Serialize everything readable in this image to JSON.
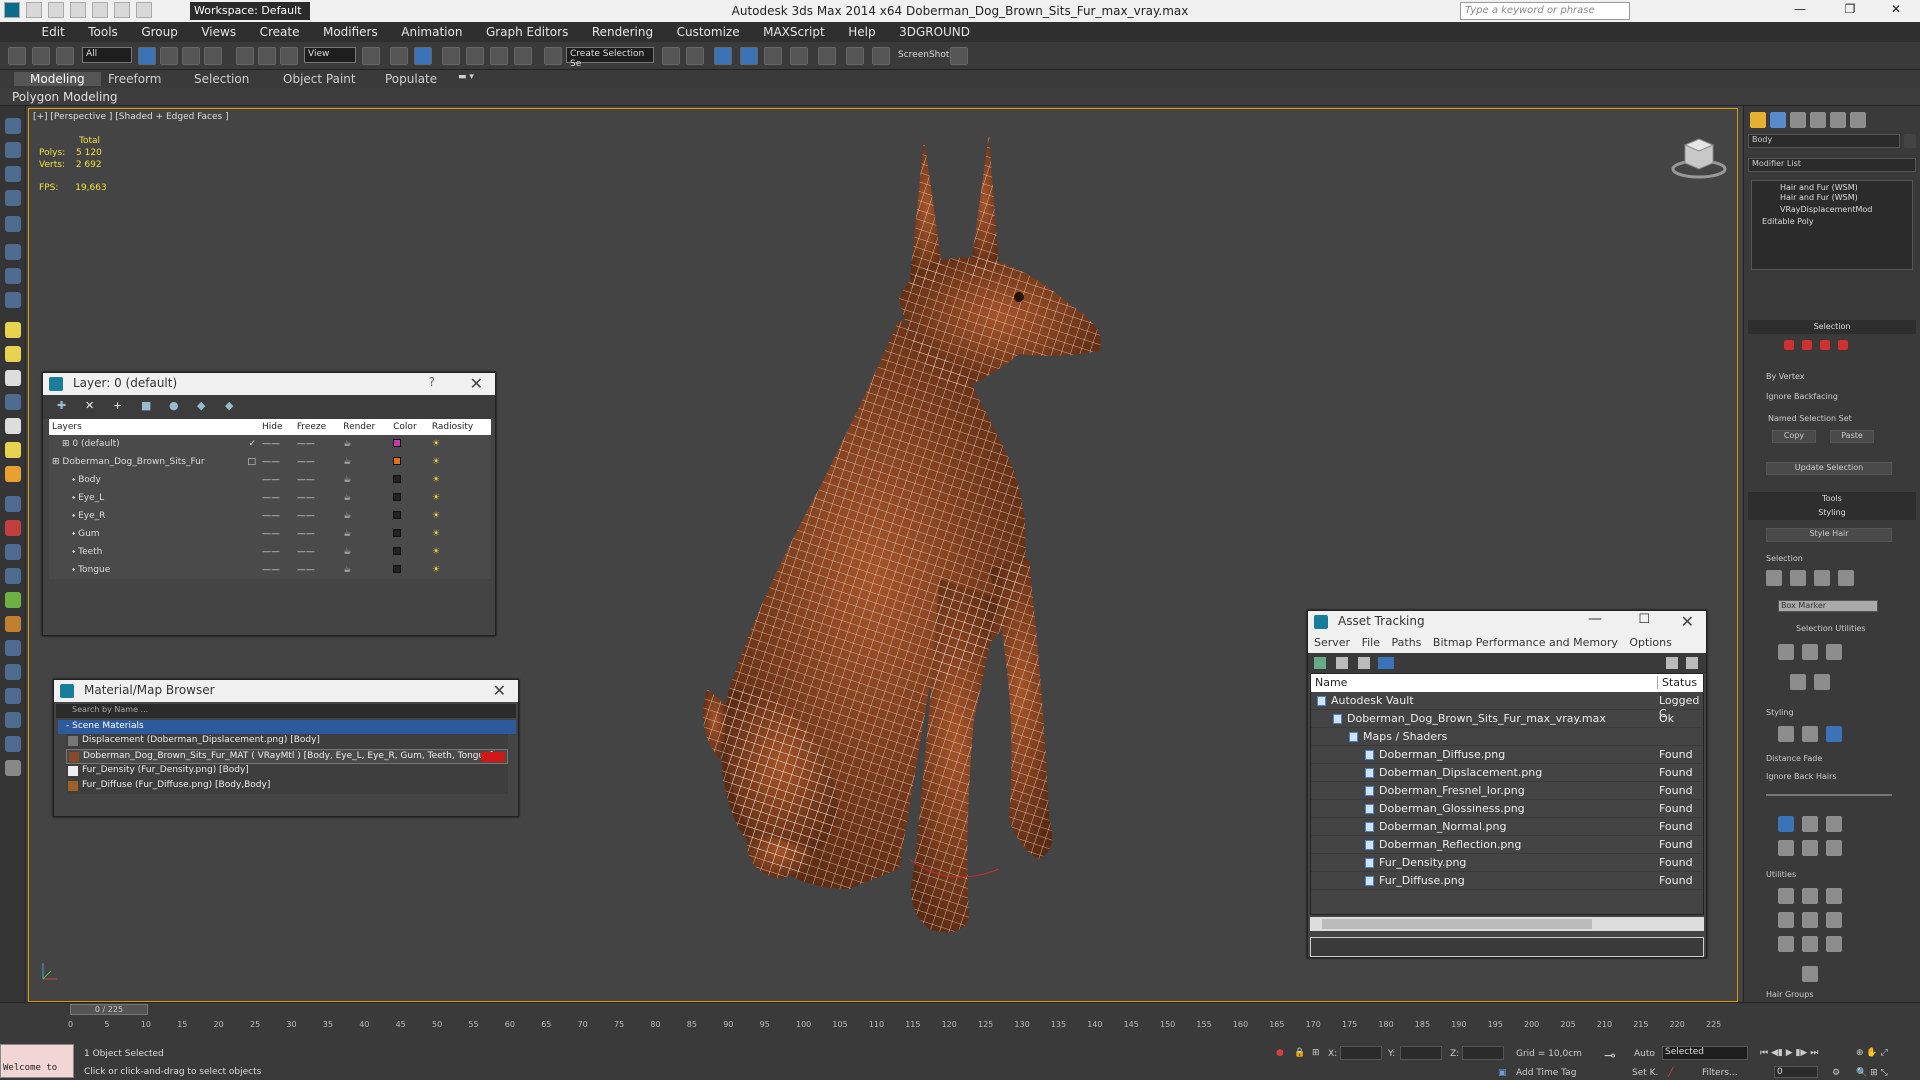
{
  "app": {
    "title": "Autodesk 3ds Max  2014 x64     Doberman_Dog_Brown_Sits_Fur_max_vray.max",
    "workspace": "Workspace: Default",
    "search_placeholder": "Type a keyword or phrase"
  },
  "menu": [
    "Edit",
    "Tools",
    "Group",
    "Views",
    "Create",
    "Modifiers",
    "Animation",
    "Graph Editors",
    "Rendering",
    "Customize",
    "MAXScript",
    "Help",
    "3DGROUND"
  ],
  "toolbar": {
    "filter": "All",
    "ref_coord": "View",
    "named_sel": "Create Selection Se",
    "screenshot": "ScreenShot"
  },
  "ribbon": {
    "tabs": [
      "Modeling",
      "Freeform",
      "Selection",
      "Object Paint",
      "Populate"
    ],
    "active_tab": "Modeling",
    "sub": "Polygon Modeling"
  },
  "viewport": {
    "label": "[+] [Perspective ] [Shaded + Edged Faces ]",
    "stats_total": "Total",
    "polys_label": "Polys:",
    "polys": "5 120",
    "verts_label": "Verts:",
    "verts": "2 692",
    "fps_label": "FPS:",
    "fps": "19,663"
  },
  "layer_panel": {
    "title": "Layer: 0 (default)",
    "columns": [
      "Layers",
      "Hide",
      "Freeze",
      "Render",
      "Color",
      "Radiosity"
    ],
    "rows": [
      {
        "name": "0 (default)",
        "indent": 1,
        "color": "#c03ab0",
        "check": "✓"
      },
      {
        "name": "Doberman_Dog_Brown_Sits_Fur",
        "indent": 0,
        "color": "#e07020",
        "check": "□"
      },
      {
        "name": "Body",
        "indent": 2,
        "color": "#222222",
        "check": ""
      },
      {
        "name": "Eye_L",
        "indent": 2,
        "color": "#222222",
        "check": ""
      },
      {
        "name": "Eye_R",
        "indent": 2,
        "color": "#222222",
        "check": ""
      },
      {
        "name": "Gum",
        "indent": 2,
        "color": "#222222",
        "check": ""
      },
      {
        "name": "Teeth",
        "indent": 2,
        "color": "#222222",
        "check": ""
      },
      {
        "name": "Tongue",
        "indent": 2,
        "color": "#222222",
        "check": ""
      }
    ]
  },
  "material_panel": {
    "title": "Material/Map Browser",
    "search": "Search by Name ...",
    "category": "- Scene Materials",
    "items": [
      "Displacement (Doberman_Dipslacement.png) [Body]",
      "Doberman_Dog_Brown_Sits_Fur_MAT  ( VRayMtl ) [Body, Eye_L, Eye_R, Gum, Teeth, Tongue]",
      "Fur_Density (Fur_Density.png) [Body]",
      "Fur_Diffuse (Fur_Diffuse.png) [Body,Body]"
    ]
  },
  "asset_panel": {
    "title": "Asset Tracking",
    "menu": [
      "Server",
      "File",
      "Paths",
      "Bitmap Performance and Memory",
      "Options"
    ],
    "col_name": "Name",
    "col_status": "Status",
    "rows": [
      {
        "name": "Autodesk Vault",
        "status": "Logged C",
        "indent": 1
      },
      {
        "name": "Doberman_Dog_Brown_Sits_Fur_max_vray.max",
        "status": "Ok",
        "indent": 2
      },
      {
        "name": "Maps / Shaders",
        "status": "",
        "indent": 3
      },
      {
        "name": "Doberman_Diffuse.png",
        "status": "Found",
        "indent": 4
      },
      {
        "name": "Doberman_Dipslacement.png",
        "status": "Found",
        "indent": 4
      },
      {
        "name": "Doberman_Fresnel_Ior.png",
        "status": "Found",
        "indent": 4
      },
      {
        "name": "Doberman_Glossiness.png",
        "status": "Found",
        "indent": 4
      },
      {
        "name": "Doberman_Normal.png",
        "status": "Found",
        "indent": 4
      },
      {
        "name": "Doberman_Reflection.png",
        "status": "Found",
        "indent": 4
      },
      {
        "name": "Fur_Density.png",
        "status": "Found",
        "indent": 4
      },
      {
        "name": "Fur_Diffuse.png",
        "status": "Found",
        "indent": 4
      }
    ]
  },
  "command_panel": {
    "object_name": "Body",
    "modifier_list": "Modifier List",
    "stack": [
      "Hair and Fur (WSM)",
      "Hair and Fur (WSM)",
      "VRayDisplacementMod",
      "Editable Poly"
    ],
    "selection": "Selection",
    "by_vertex": "By Vertex",
    "ignore_backfacing": "Ignore Backfacing",
    "named_selection_set": "Named Selection Set",
    "copy": "Copy",
    "paste": "Paste",
    "update_selection": "Update Selection",
    "tools": "Tools",
    "styling": "Styling",
    "style_hair": "Style Hair",
    "sub_selection": "Selection",
    "box_marker": "Box Marker",
    "selection_utilities": "Selection Utilities",
    "sub_styling": "Styling",
    "distance_fade": "Distance Fade",
    "ignore_back_hairs": "Ignore Back Hairs",
    "utilities": "Utilities",
    "hair_groups": "Hair Groups"
  },
  "timeline": {
    "slider": "0 / 225",
    "ticks": [
      "0",
      "5",
      "10",
      "15",
      "20",
      "25",
      "30",
      "35",
      "40",
      "45",
      "50",
      "55",
      "60",
      "65",
      "70",
      "75",
      "80",
      "85",
      "90",
      "95",
      "100",
      "105",
      "110",
      "115",
      "120",
      "125",
      "130",
      "135",
      "140",
      "145",
      "150",
      "155",
      "160",
      "165",
      "170",
      "175",
      "180",
      "185",
      "190",
      "195",
      "200",
      "205",
      "210",
      "215",
      "220",
      "225"
    ]
  },
  "status": {
    "maxscript": "Welcome to",
    "selected": "1 Object Selected",
    "prompt": "Click or click-and-drag to select objects",
    "x": "X:",
    "y": "Y:",
    "z": "Z:",
    "grid": "Grid = 10,0cm",
    "add_time_tag": "Add Time Tag",
    "auto": "Auto",
    "selected_dd": "Selected",
    "set_k": "Set K.",
    "filters": "Filters...",
    "frame": "0"
  }
}
